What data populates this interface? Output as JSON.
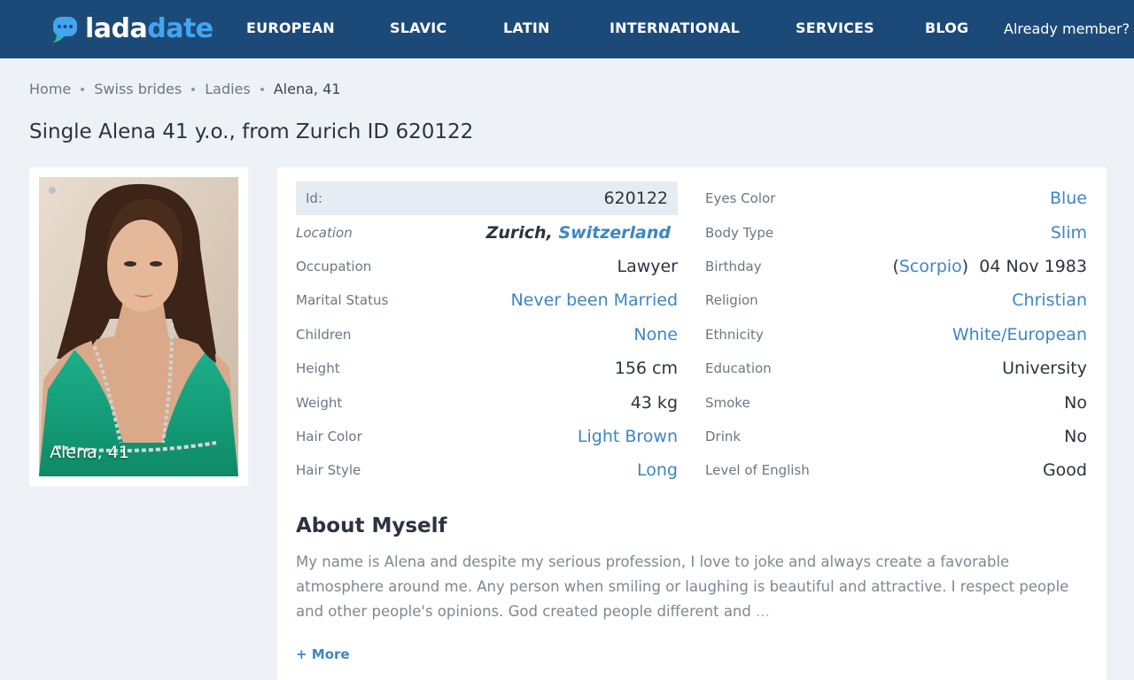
{
  "header": {
    "logo": {
      "part1": "lada",
      "part2": "date"
    },
    "nav": [
      "EUROPEAN",
      "SLAVIC",
      "LATIN",
      "INTERNATIONAL",
      "SERVICES",
      "BLOG"
    ],
    "member_link": "Already member?"
  },
  "breadcrumb": [
    "Home",
    "Swiss brides",
    "Ladies",
    "Alena, 41"
  ],
  "page_title": "Single Alena 41 y.o., from Zurich ID 620122",
  "photo": {
    "caption": "Alena, 41"
  },
  "profile": {
    "left": [
      {
        "label": "Id:",
        "value": "620122"
      },
      {
        "label": "Location",
        "city": "Zurich,",
        "country": "Switzerland"
      },
      {
        "label": "Occupation",
        "value": "Lawyer"
      },
      {
        "label": "Marital Status",
        "value": "Never been Married"
      },
      {
        "label": "Children",
        "value": "None"
      },
      {
        "label": "Height",
        "value": "156 cm"
      },
      {
        "label": "Weight",
        "value": "43 kg"
      },
      {
        "label": "Hair Color",
        "value": "Light Brown"
      },
      {
        "label": "Hair Style",
        "value": "Long"
      }
    ],
    "right": [
      {
        "label": "Eyes Color",
        "value": "Blue"
      },
      {
        "label": "Body Type",
        "value": "Slim"
      },
      {
        "label": "Birthday",
        "zodiac": "Scorpio",
        "value": "04 Nov 1983"
      },
      {
        "label": "Religion",
        "value": "Christian"
      },
      {
        "label": "Ethnicity",
        "value": "White/European"
      },
      {
        "label": "Education",
        "value": "University"
      },
      {
        "label": "Smoke",
        "value": "No"
      },
      {
        "label": "Drink",
        "value": "No"
      },
      {
        "label": "Level of English",
        "value": "Good"
      }
    ]
  },
  "about": {
    "title": "About Myself",
    "text": "My name is Alena and despite my serious profession, I love to joke and always create a favorable atmosphere around me. Any person when smiling or laughing is beautiful and attractive. I respect people and other people's opinions. God created people different and",
    "ellipsis": "...",
    "more": "+ More"
  },
  "colors": {
    "header": "#1c4a78",
    "accent": "#3d86c6",
    "logo_accent": "#43a5f0",
    "page_bg": "#eef2f7"
  },
  "icons": [
    "chat-bubble-logo-icon"
  ]
}
